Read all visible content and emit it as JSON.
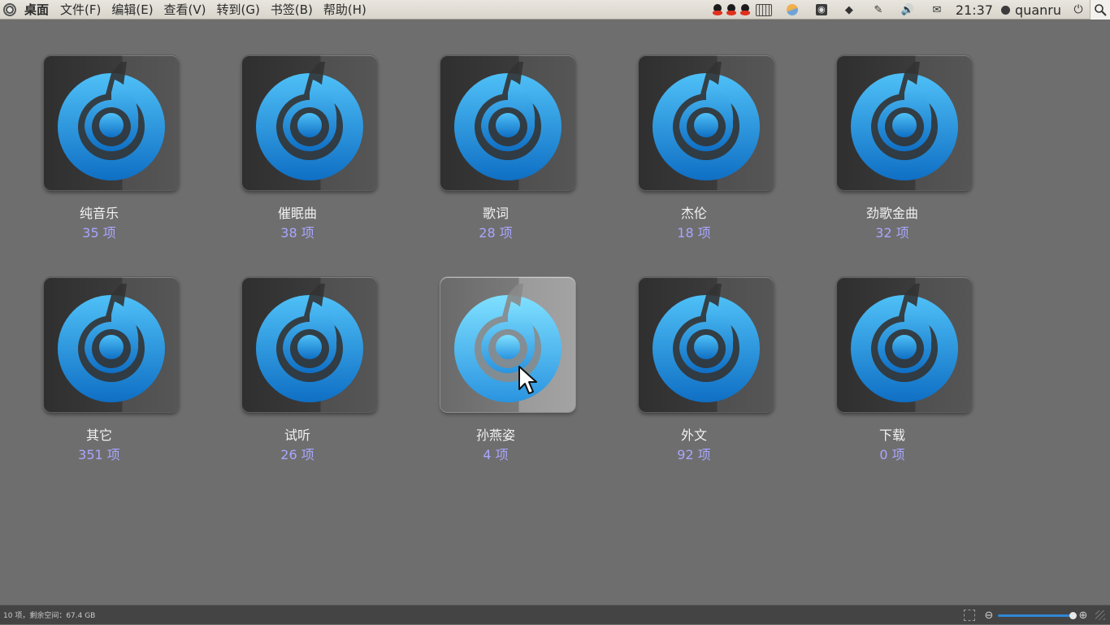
{
  "menubar": {
    "app_title": "桌面",
    "items": [
      "文件(F)",
      "编辑(E)",
      "查看(V)",
      "转到(G)",
      "书签(B)",
      "帮助(H)"
    ]
  },
  "tray": {
    "icons": [
      "qq-icon",
      "qq-icon",
      "qq-icon",
      "keyboard-icon",
      "weather-icon",
      "rss-icon",
      "network-icon",
      "pen-icon",
      "volume-icon",
      "mail-icon"
    ],
    "clock": "21:37",
    "user": "quanru"
  },
  "folders": [
    {
      "name": "纯音乐",
      "count": "35 项"
    },
    {
      "name": "催眠曲",
      "count": "38 项"
    },
    {
      "name": "歌词",
      "count": "28 项"
    },
    {
      "name": "杰伦",
      "count": "18 项"
    },
    {
      "name": "劲歌金曲",
      "count": "32 项"
    },
    {
      "name": "其它",
      "count": "351 项"
    },
    {
      "name": "试听",
      "count": "26 项"
    },
    {
      "name": "孙燕姿",
      "count": "4 项"
    },
    {
      "name": "外文",
      "count": "92 项"
    },
    {
      "name": "下载",
      "count": "0 项"
    }
  ],
  "statusbar": {
    "text": "10 项，剩余空间：67.4 GB",
    "zoom_level": 1.0
  },
  "colors": {
    "desktop_bg": "#6e6e6e",
    "label": "#f2f2f2",
    "count": "#a9a6ff",
    "accent": "#2f86d4"
  }
}
